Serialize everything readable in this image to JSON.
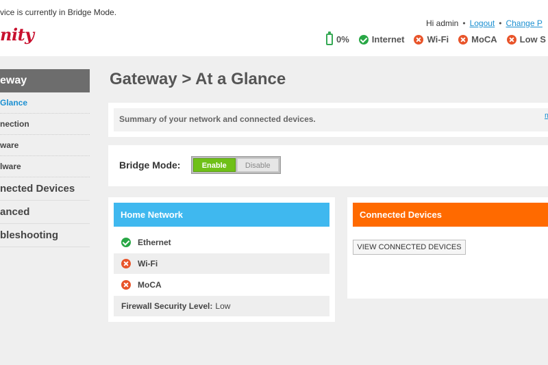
{
  "header": {
    "bridge_message": "vice is currently in Bridge Mode.",
    "logo_text": "nity",
    "greeting": "Hi admin",
    "logout_label": "Logout",
    "change_password_label": "Change P",
    "status": {
      "battery": "0%",
      "internet": "Internet",
      "wifi": "Wi-Fi",
      "moca": "MoCA",
      "security": "Low S"
    }
  },
  "sidebar": {
    "active_section": "eway",
    "sub_items": [
      "Glance",
      "nection",
      "ware",
      "lware"
    ],
    "main_items": [
      "nected Devices",
      "anced",
      "bleshooting"
    ]
  },
  "main": {
    "page_title": "Gateway > At a Glance",
    "summary_text": "Summary of your network and connected devices.",
    "more_link": "m",
    "bridge_mode_label": "Bridge Mode:",
    "enable_label": "Enable",
    "disable_label": "Disable"
  },
  "home_network": {
    "title": "Home Network",
    "rows": [
      {
        "label": "Ethernet",
        "status": "ok"
      },
      {
        "label": "Wi-Fi",
        "status": "error"
      },
      {
        "label": "MoCA",
        "status": "error"
      }
    ],
    "firewall_label": "Firewall Security Level:",
    "firewall_value": "Low"
  },
  "connected_devices": {
    "title": "Connected Devices",
    "view_button": "VIEW CONNECTED DEVICES"
  },
  "colors": {
    "accent_blue": "#3fb8ef",
    "accent_orange": "#ff6a00",
    "ok_green": "#28a745",
    "error_red": "#e8542a",
    "brand_red": "#c8102e"
  }
}
